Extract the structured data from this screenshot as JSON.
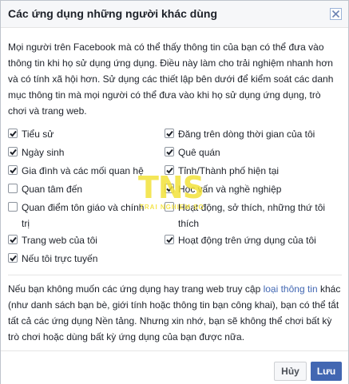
{
  "dialog": {
    "title": "Các ứng dụng những người khác dùng",
    "intro": "Mọi người trên Facebook mà có thể thấy thông tin của bạn có thể đưa vào thông tin khi họ sử dụng ứng dụng. Điều này làm cho trải nghiệm nhanh hơn và có tính xã hội hơn. Sử dụng các thiết lập bên dưới để kiểm soát các danh mục thông tin mà mọi người có thể đưa vào khi họ sử dụng ứng dụng, trò chơi và trang web.",
    "permissions": [
      {
        "label": "Tiểu sử",
        "checked": true
      },
      {
        "label": "Đăng trên dòng thời gian của tôi",
        "checked": true
      },
      {
        "label": "Ngày sinh",
        "checked": true
      },
      {
        "label": "Quê quán",
        "checked": true
      },
      {
        "label": "Gia đình và các mối quan hệ",
        "checked": true
      },
      {
        "label": "Tỉnh/Thành phố hiện tại",
        "checked": true
      },
      {
        "label": "Quan tâm đến",
        "checked": false
      },
      {
        "label": "Học vấn và nghề nghiệp",
        "checked": true
      },
      {
        "label": "Quan điểm tôn giáo và chính trị",
        "checked": false
      },
      {
        "label": "Hoạt động, sở thích, những thứ tôi thích",
        "checked": false
      },
      {
        "label": "Trang web của tôi",
        "checked": true
      },
      {
        "label": "Hoạt động trên ứng dụng của tôi",
        "checked": true
      },
      {
        "label": "Nếu tôi trực tuyến",
        "checked": true
      }
    ],
    "footer_before": "Nếu bạn không muốn các ứng dụng hay trang web truy cập ",
    "footer_link": "loại thông tin",
    "footer_after": " khác (như danh sách bạn bè, giới tính hoặc thông tin bạn công khai), bạn có thể tắt tất cả các ứng dụng Nền tảng. Nhưng xin nhớ, bạn sẽ không thể chơi bất kỳ trò chơi hoặc dùng bất kỳ ứng dụng của bạn được nữa.",
    "cancel_label": "Hủy",
    "save_label": "Lưu"
  },
  "watermark": {
    "logo_text": "TNS",
    "tagline": "TRAI NGHIEM SO"
  },
  "colors": {
    "accent": "#4267b2",
    "watermark": "#f3e23a"
  }
}
